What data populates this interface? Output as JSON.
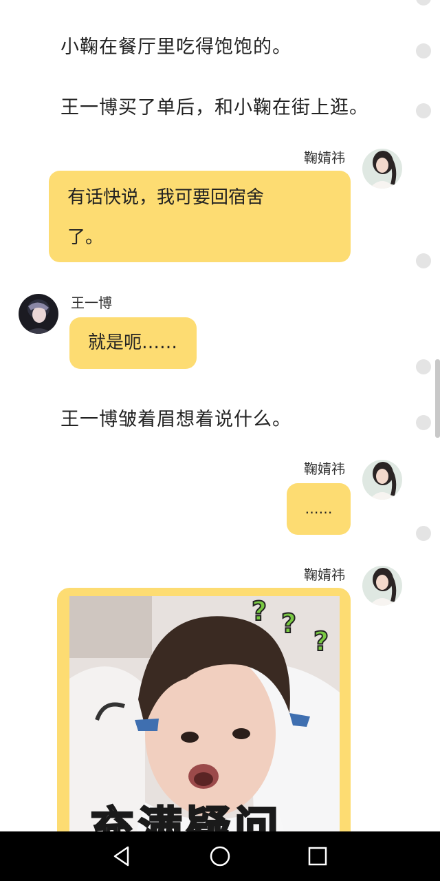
{
  "narration": [
    "小鞠在餐厅里吃得饱饱的。",
    "王一博买了单后，和小鞠在街上逛。",
    "王一博皱着眉想着说什么。"
  ],
  "messages": [
    {
      "sender": "鞠婧祎",
      "side": "right",
      "text_lines": [
        "有话快说，我可要回宿舍",
        "了。"
      ]
    },
    {
      "sender": "王一博",
      "side": "left",
      "text": "就是呃……"
    },
    {
      "sender": "鞠婧祎",
      "side": "right",
      "text": "……"
    },
    {
      "sender": "鞠婧祎",
      "side": "right",
      "sticker": {
        "caption": "充满疑问"
      }
    }
  ],
  "colors": {
    "bubble": "#fddc72",
    "navbar": "#000000",
    "dots": "#e4e4e4"
  },
  "navbar": {
    "icons": [
      "back-icon",
      "home-icon",
      "recents-icon"
    ]
  }
}
